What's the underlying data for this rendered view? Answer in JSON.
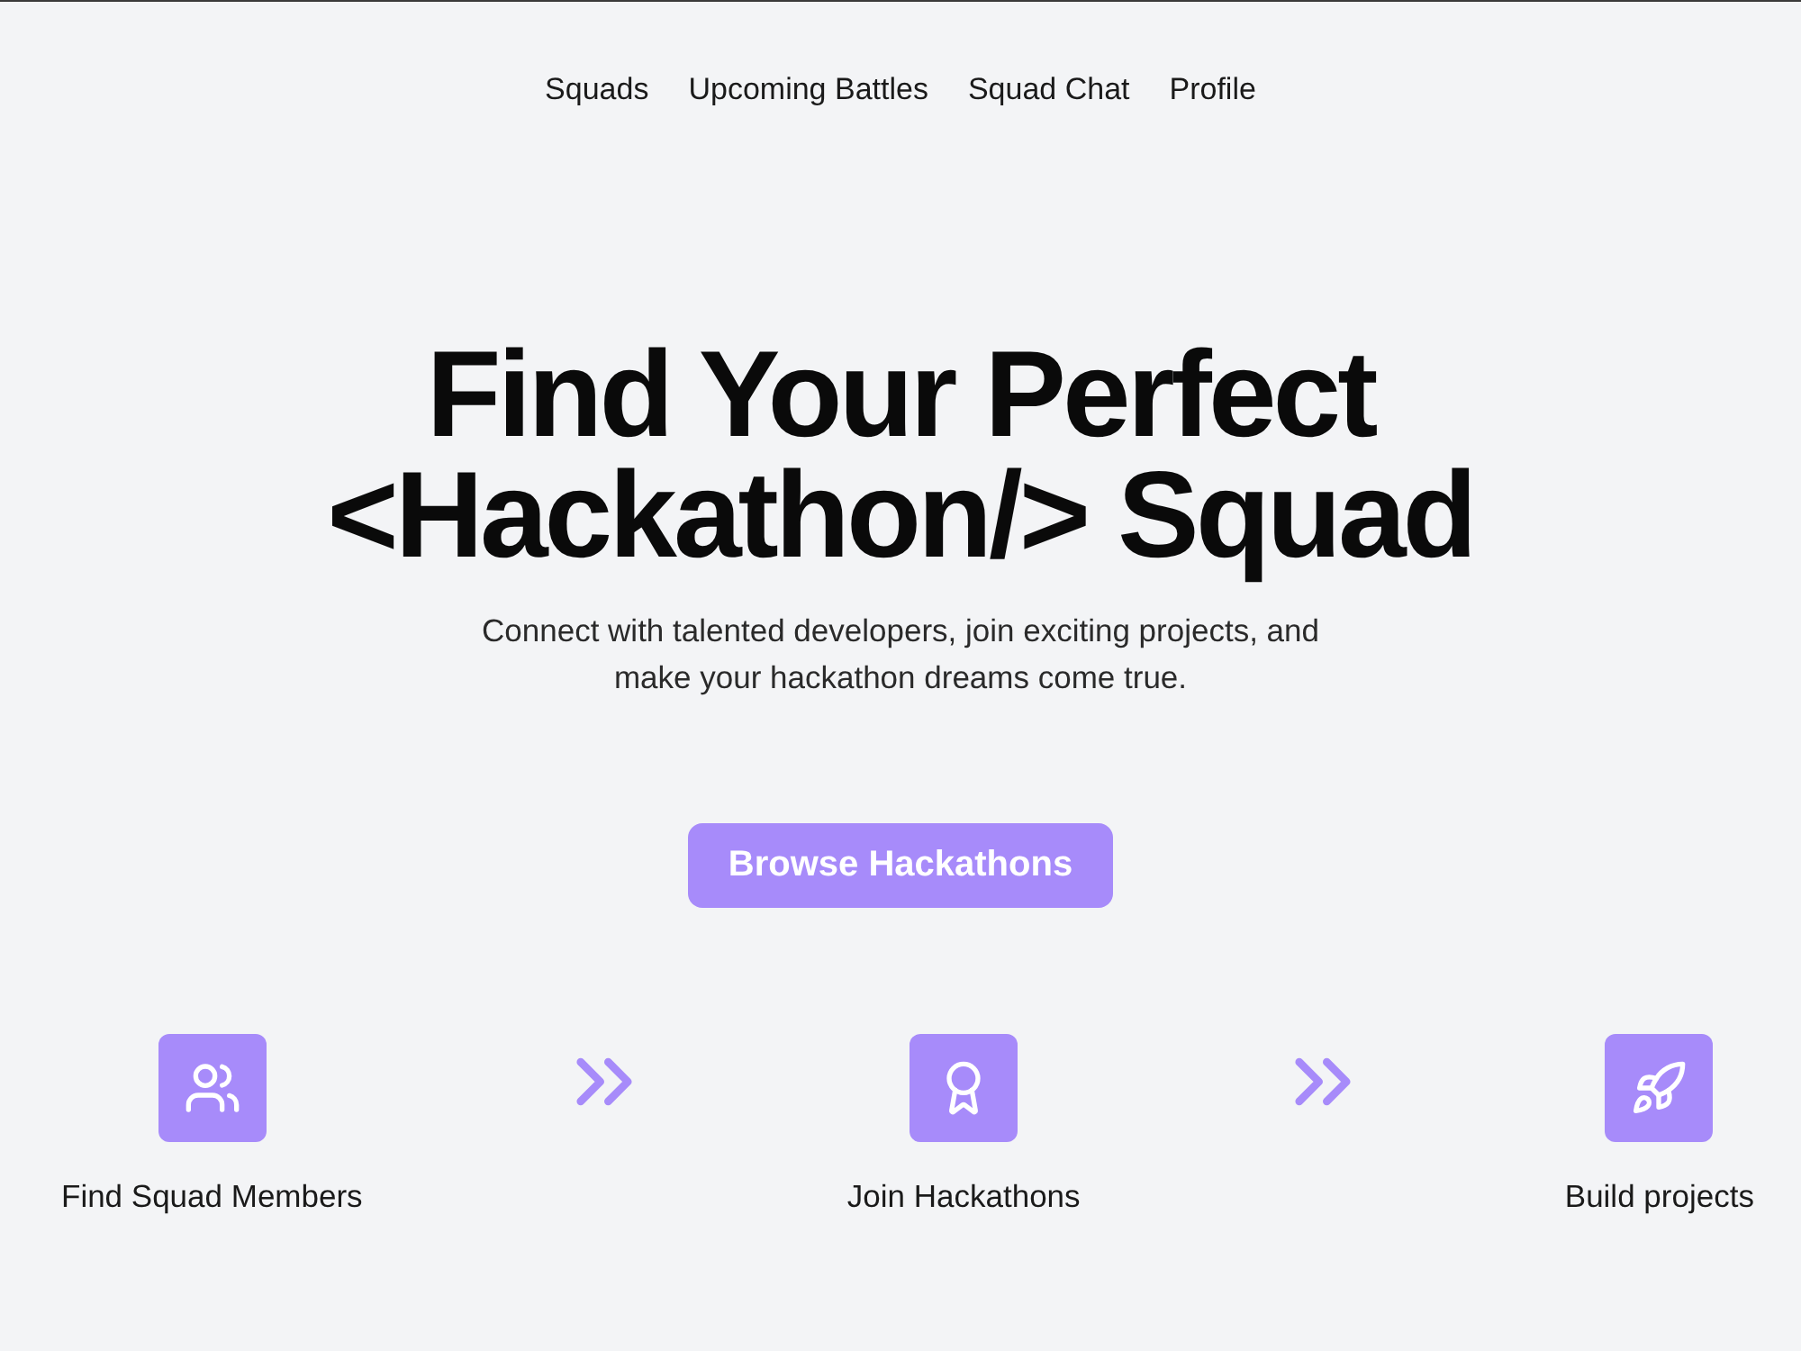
{
  "nav": {
    "links": [
      "Squads",
      "Upcoming Battles",
      "Squad Chat",
      "Profile"
    ]
  },
  "hero": {
    "title_lines": [
      "Find Your Perfect",
      "<Hackathon/> Squad"
    ],
    "subtitle_lines": [
      "Connect with talented developers, join exciting projects, and",
      "make your hackathon dreams come true."
    ],
    "button": "Browse Hackathons"
  },
  "steps": [
    {
      "label": "Find Squad Members"
    },
    {
      "label": "Join Hackathons"
    },
    {
      "label": "Build projects"
    }
  ]
}
